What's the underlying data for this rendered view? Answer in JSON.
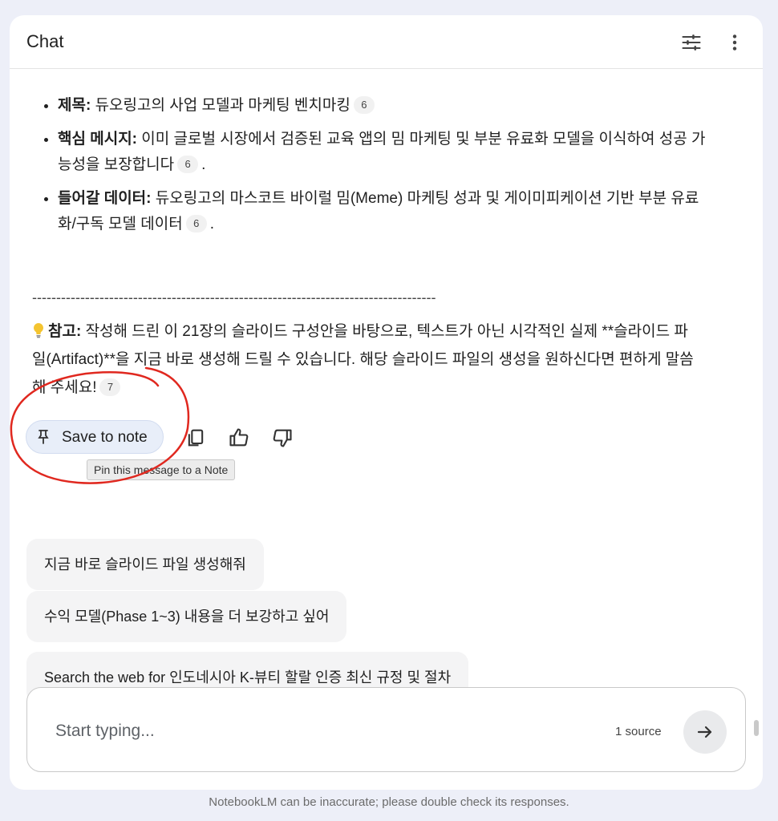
{
  "header": {
    "title": "Chat",
    "icons": [
      "tune-icon",
      "more-vert-icon"
    ]
  },
  "bullets": [
    {
      "label": "제목:",
      "text": " 듀오링고의 사업 모델과 마케팅 벤치마킹",
      "cite": "6",
      "tail": ""
    },
    {
      "label": "핵심 메시지:",
      "text": " 이미 글로벌 시장에서 검증된 교육 앱의 밈 마케팅 및 부분 유료화 모델을 이식하여 성공 가능성을 보장합니다",
      "cite": "6",
      "tail": "."
    },
    {
      "label": "들어갈 데이터:",
      "text": " 듀오링고의 마스코트 바이럴 밈(Meme) 마케팅 성과 및 게이미피케이션 기반 부분 유료화/구독 모델 데이터",
      "cite": "6",
      "tail": "."
    }
  ],
  "divider": "------------------------------------------------------------------------------------",
  "note": {
    "label": "참고:",
    "text": " 작성해 드린 이 21장의 슬라이드 구성안을 바탕으로, 텍스트가 아닌 시각적인 실제 **슬라이드 파일(Artifact)**을 지금 바로 생성해 드릴 수 있습니다. 해당 슬라이드 파일의 생성을 원하신다면 편하게 말씀해 주세요!",
    "cite": "7"
  },
  "actions": {
    "save_label": "Save to note",
    "tooltip": "Pin this message to a Note"
  },
  "suggestions": [
    "지금 바로 슬라이드 파일 생성해줘",
    "수익 모델(Phase 1~3) 내용을 더 보강하고 싶어",
    "Search the web for 인도네시아 K-뷰티 할랄 인증 최신 규정 및 절차"
  ],
  "composer": {
    "placeholder": "Start typing...",
    "source_count": "1 source"
  },
  "disclaimer": "NotebookLM can be inaccurate; please double check its responses.",
  "colors": {
    "annotation": "#e0281f",
    "save_bg": "#e8eef9",
    "accent_bulb": "#f4c430"
  }
}
